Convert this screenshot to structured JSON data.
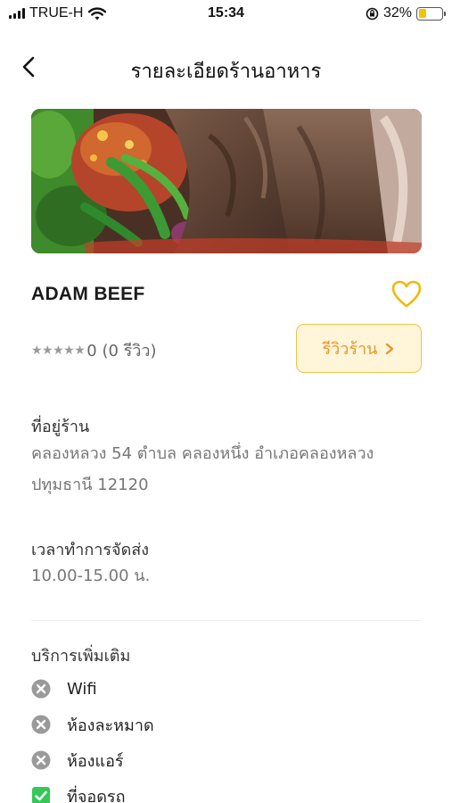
{
  "status_bar": {
    "carrier": "TRUE-H",
    "time": "15:34",
    "battery_percent": "32%",
    "battery_level": 0.32,
    "battery_color": "#f2c400"
  },
  "nav": {
    "title": "รายละเอียดร้านอาหาร",
    "back_icon": "chevron-left-icon"
  },
  "store": {
    "name": "ADAM BEEF",
    "favorite_icon": "heart-outline-icon",
    "favorite_color": "#f0b90b",
    "rating": {
      "stars": "★★★★★",
      "text": "0 (0 รีวิว)",
      "score": 0
    },
    "review_button": {
      "label": "รีวิวร้าน",
      "icon": "chevron-right-icon"
    }
  },
  "address": {
    "label": "ที่อยู่ร้าน",
    "value": "คลองหลวง 54 ตำบล คลองหนึ่ง อำเภอคลองหลวง ปทุมธานี 12120"
  },
  "delivery_hours": {
    "label": "เวลาทำการจัดส่ง",
    "value": "10.00-15.00 น."
  },
  "services": {
    "label": "บริการเพิ่มเติม",
    "items": [
      {
        "label": "Wifi",
        "available": false,
        "icon": "x-circle-icon"
      },
      {
        "label": "ห้องละหมาด",
        "available": false,
        "icon": "x-circle-icon"
      },
      {
        "label": "ห้องแอร์",
        "available": false,
        "icon": "x-circle-icon"
      },
      {
        "label": "ที่จอดรถ",
        "available": true,
        "icon": "check-box-icon"
      }
    ]
  },
  "colors": {
    "accent": "#e8962a",
    "accent_bg": "#fff5d9",
    "available_green": "#35c759",
    "unavailable_gray": "#9a9a9a"
  }
}
